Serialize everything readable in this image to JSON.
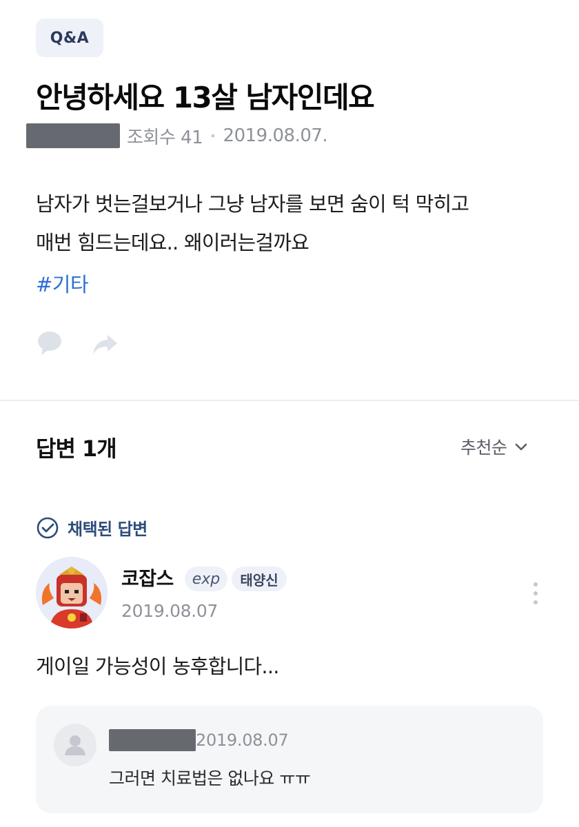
{
  "post": {
    "badge": "Q&A",
    "title": "안녕하세요 13살 남자인데요",
    "views": "조회수 41",
    "separator": "•",
    "date": "2019.08.07.",
    "body_line1": "남자가 벗는걸보거나 그냥 남자를 보면 숨이 턱 막히고",
    "body_line2": "매번 힘드는데요.. 왜이러는걸까요",
    "tag": "#기타"
  },
  "actions": {
    "comment_icon": "comment-bubble-icon",
    "share_icon": "share-arrow-icon"
  },
  "answers": {
    "title": "답변 1개",
    "sort_label": "추천순",
    "sort_icon": "chevron-down-icon",
    "accepted_label": "채택된 답변",
    "accepted_icon": "check-circle-icon",
    "answer": {
      "user_name": "코잡스",
      "exp_badge": "exp",
      "level_badge": "태양신",
      "date": "2019.08.07",
      "text": "게이일 가능성이 농후합니다...",
      "more_icon": "more-vertical-icon"
    },
    "reply": {
      "date": "2019.08.07",
      "text": "그러면 치료법은 없나요 ㅠㅠ",
      "avatar_icon": "default-user-icon"
    }
  },
  "colors": {
    "accent_blue": "#2a6fd6",
    "accepted_navy": "#2d4b7a",
    "muted_text": "#8e9199",
    "badge_bg": "#eef1f8"
  }
}
